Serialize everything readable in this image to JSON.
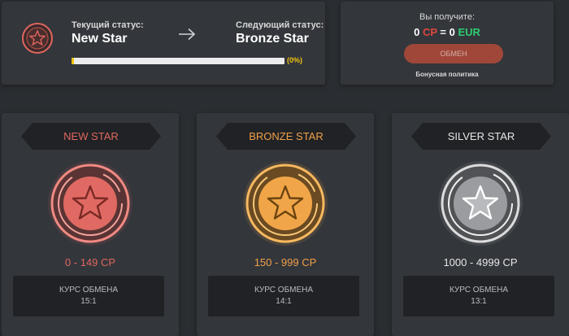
{
  "status": {
    "current_label": "Текущий статус:",
    "current_value": "New Star",
    "next_label": "Следующий статус:",
    "next_value": "Bronze Star",
    "progress_text": "(0%)",
    "progress_fraction": 0
  },
  "exchange": {
    "title": "Вы получите:",
    "cp_amount": "0",
    "cp_unit": "CP",
    "equals": "=",
    "eur_amount": "0",
    "eur_unit": "EUR",
    "button_label": "ОБМЕН",
    "link_label": "Бонусная политика"
  },
  "levels": [
    {
      "name": "NEW STAR",
      "range": "0 - 149 CP",
      "rate_label": "КУРС ОБМЕНА",
      "rate_value": "15:1",
      "color": "#e0665f",
      "icon": "red-star-medal-icon"
    },
    {
      "name": "BRONZE STAR",
      "range": "150 - 999 CP",
      "rate_label": "КУРС ОБМЕНА",
      "rate_value": "14:1",
      "color": "#f0a048",
      "icon": "bronze-star-medal-icon"
    },
    {
      "name": "SILVER STAR",
      "range": "1000 - 4999 CP",
      "rate_label": "КУРС ОБМЕНА",
      "rate_value": "13:1",
      "color": "#e6e6e6",
      "icon": "silver-star-medal-icon"
    }
  ],
  "colors": {
    "background": "#2a2d31",
    "panel": "#33363b",
    "progress": "#f1c40f",
    "cp": "#e0473e",
    "eur": "#2ecc71",
    "button": "#b34a39"
  }
}
